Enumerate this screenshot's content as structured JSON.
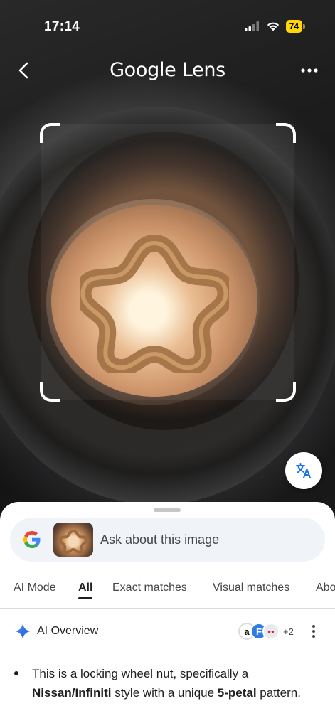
{
  "status_bar": {
    "time": "17:14",
    "battery": "74"
  },
  "header": {
    "title": "Google Lens"
  },
  "search": {
    "placeholder": "Ask about this image"
  },
  "tabs": [
    {
      "label": "AI Mode"
    },
    {
      "label": "All"
    },
    {
      "label": "Exact matches"
    },
    {
      "label": "Visual matches"
    },
    {
      "label": "Abo"
    }
  ],
  "active_tab": "All",
  "ai_overview": {
    "label": "AI Overview",
    "sources_more": "+2",
    "bullet": {
      "part1": "This is a locking wheel nut, specifically a ",
      "bold1": "Nissan/Infiniti",
      "part2": " style with a unique ",
      "bold2": "5-petal",
      "part3": " pattern."
    }
  },
  "icons": {
    "back": "chevron-left-icon",
    "more": "more-horizontal-icon",
    "translate": "translate-icon",
    "google": "google-g-icon",
    "spark": "ai-spark-icon",
    "kebab": "more-vertical-icon"
  },
  "colors": {
    "accent": "#1a73e8",
    "battery": "#ffd60a",
    "sheet_bg": "#ffffff",
    "search_bg": "#f0f3f8"
  }
}
